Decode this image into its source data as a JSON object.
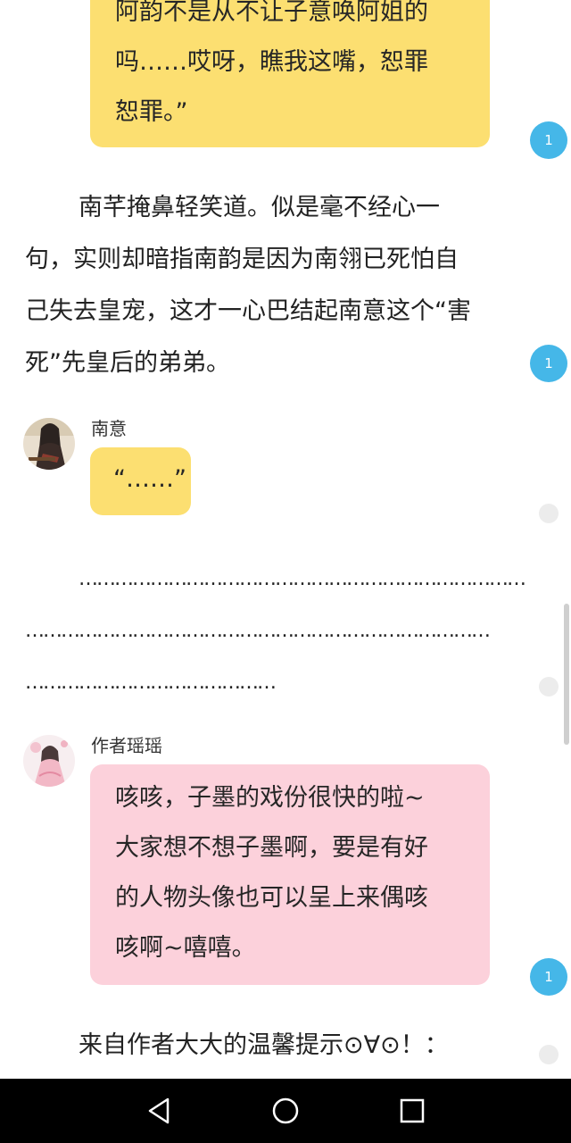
{
  "messages": {
    "top_bubble": {
      "lines": [
        "阿韵不是从不让子意唤阿姐的",
        "吗……哎呀，瞧我这嘴，恕罪",
        "恕罪。”"
      ]
    },
    "para1": {
      "lines": [
        "南芊掩鼻轻笑道。似是毫不经心一",
        "句，实则却暗指南韵是因为南翎已死怕自",
        "己失去皇宠，这才一心巴结起南意这个“害",
        "死”先皇后的弟弟。"
      ]
    },
    "nanyi": {
      "name": "南意",
      "bubble": "“……”"
    },
    "dots_para": {
      "lines": [
        "…………………………………………………………………",
        "……………………………………………………………………",
        "……………………………………"
      ]
    },
    "author": {
      "name": "作者瑶瑶",
      "lines": [
        "咳咳，子墨的戏份很快的啦~",
        "大家想不想子墨啊，要是有好",
        "的人物头像也可以呈上来偶咳",
        "咳啊~嘻嘻。"
      ]
    },
    "tip": {
      "text": "来自作者大大的温馨提示⊙∀⊙！："
    }
  },
  "badges": {
    "b1": "1",
    "b2": "1",
    "b3": "1"
  },
  "icons": {
    "nav_back": "triangle-back-icon",
    "nav_home": "circle-home-icon",
    "nav_recent": "square-recent-icon"
  },
  "colors": {
    "yellow_bubble": "#fcdf71",
    "pink_bubble": "#fcd1db",
    "badge": "#45b7e8",
    "navbar": "#000000"
  }
}
